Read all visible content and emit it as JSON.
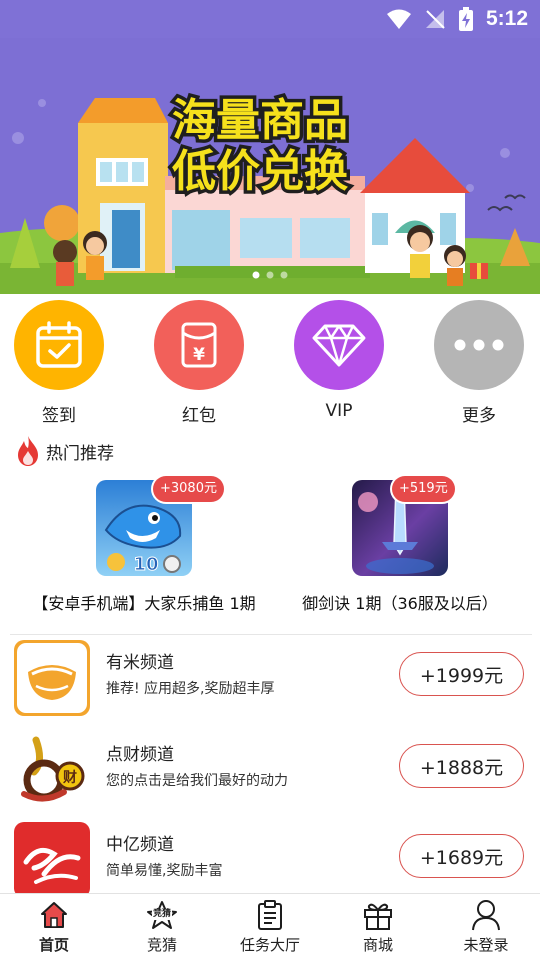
{
  "status_bar": {
    "time": "5:12"
  },
  "banner": {
    "headline_line1": "海量商品",
    "headline_line2": "低价兑换",
    "slide_count": 3,
    "active_slide": 1
  },
  "quick_actions": [
    {
      "label": "签到",
      "icon": "calendar-check-icon",
      "color": "#ffb400"
    },
    {
      "label": "红包",
      "icon": "red-envelope-icon",
      "color": "#f2605a"
    },
    {
      "label": "VIP",
      "icon": "diamond-icon",
      "color": "#b450e8"
    },
    {
      "label": "更多",
      "icon": "more-dots-icon",
      "color": "#b5b5b5"
    }
  ],
  "hot": {
    "title": "热门推荐",
    "games": [
      {
        "name": "【安卓手机端】大家乐捕鱼 1期",
        "reward": "+3080元"
      },
      {
        "name": "御剑诀 1期（36服及以后）",
        "reward": "+519元"
      }
    ]
  },
  "channels": [
    {
      "name": "有米频道",
      "desc": "推荐! 应用超多,奖励超丰厚",
      "reward": "+1999元"
    },
    {
      "name": "点财频道",
      "desc": "您的点击是给我们最好的动力",
      "reward": "+1888元"
    },
    {
      "name": "中亿频道",
      "desc": "简单易懂,奖励丰富",
      "reward": "+1689元"
    }
  ],
  "bottom_nav": [
    {
      "label": "首页",
      "icon": "home-icon",
      "active": true
    },
    {
      "label": "竞猜",
      "icon": "quiz-star-icon",
      "badge": "竞猜"
    },
    {
      "label": "任务大厅",
      "icon": "clipboard-icon"
    },
    {
      "label": "商城",
      "icon": "gift-icon"
    },
    {
      "label": "未登录",
      "icon": "user-icon"
    }
  ],
  "colors": {
    "accent_red": "#e64a4a",
    "status_bar": "#7f71d6"
  }
}
